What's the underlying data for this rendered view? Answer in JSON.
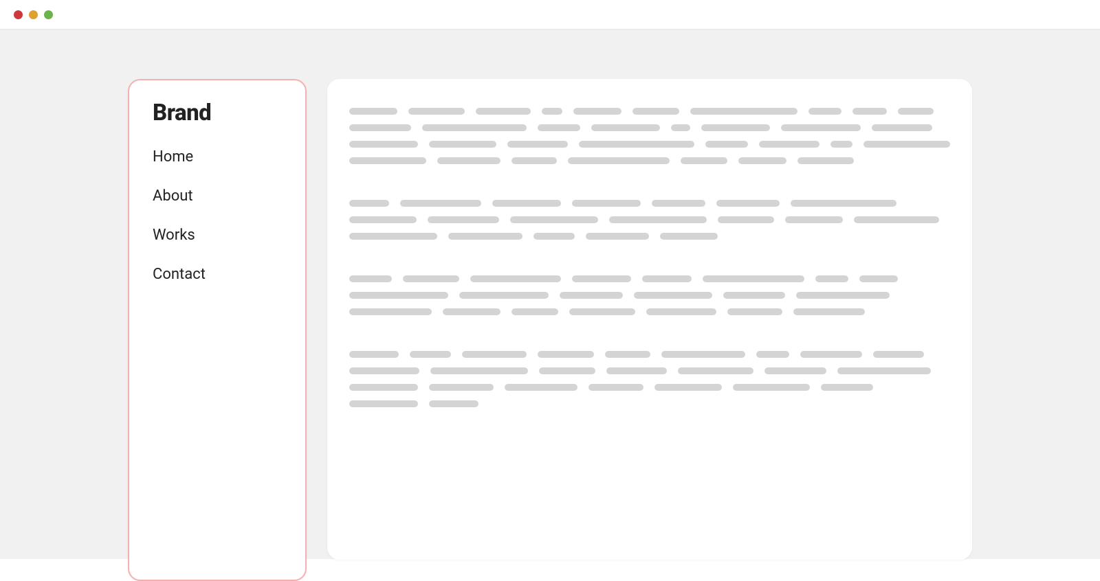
{
  "sidebar": {
    "brand": "Brand",
    "nav": [
      {
        "label": "Home"
      },
      {
        "label": "About"
      },
      {
        "label": "Works"
      },
      {
        "label": "Contact"
      }
    ]
  },
  "colors": {
    "sidebar_border": "#f4b0b0",
    "skeleton": "#d4d4d4",
    "page_bg": "#f1f1f1"
  },
  "content": {
    "paragraphs": [
      {
        "line_widths": [
          70,
          82,
          80,
          30,
          70,
          68,
          156,
          48,
          50,
          52,
          90,
          152,
          62,
          100,
          28,
          100,
          116,
          88,
          100,
          98,
          88,
          168,
          62,
          88,
          32,
          126,
          112,
          92,
          66,
          148,
          68,
          70,
          82
        ]
      },
      {
        "line_widths": [
          58,
          118,
          100,
          100,
          78,
          92,
          154,
          98,
          104,
          128,
          142,
          82,
          84,
          124,
          128,
          108,
          60,
          92,
          84
        ]
      },
      {
        "line_widths": [
          62,
          82,
          132,
          86,
          72,
          148,
          48,
          56,
          144,
          130,
          92,
          114,
          90,
          136,
          120,
          84,
          68,
          96,
          102,
          80,
          104
        ]
      },
      {
        "line_widths": [
          72,
          60,
          94,
          82,
          66,
          122,
          48,
          90,
          74,
          102,
          142,
          82,
          88,
          110,
          90,
          136,
          100,
          94,
          106,
          80,
          98,
          112,
          76,
          100,
          72
        ]
      }
    ]
  }
}
